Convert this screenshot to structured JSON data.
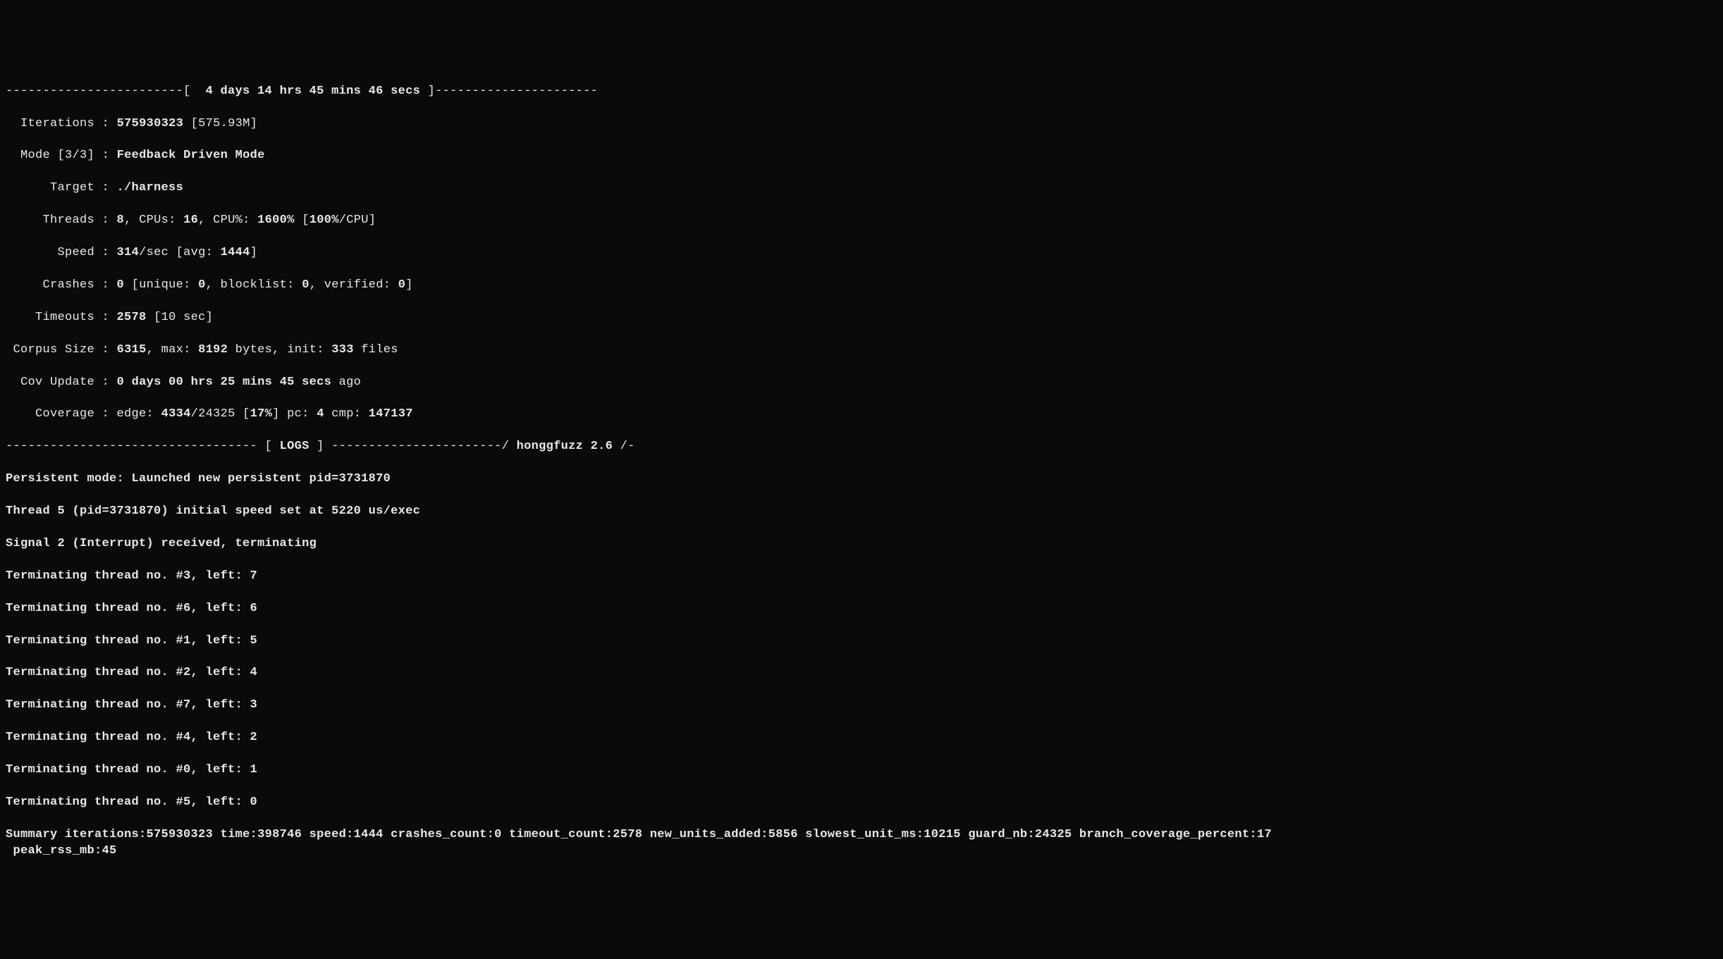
{
  "header": {
    "runtime": "4 days 14 hrs 45 mins 46 secs"
  },
  "stats": {
    "iterations": {
      "label": "Iterations",
      "value": "575930323",
      "human": "[575.93M]"
    },
    "mode": {
      "label": "Mode",
      "idx": "[3/3]",
      "value": "Feedback Driven Mode"
    },
    "target": {
      "label": "Target",
      "value": "./harness"
    },
    "threads": {
      "label": "Threads",
      "value": "8",
      "cpus_label": "CPUs:",
      "cpus": "16",
      "cpupct_label": "CPU%:",
      "cpupct": "1600%",
      "percpu": "100%",
      "percpu_suffix": "/CPU]"
    },
    "speed": {
      "label": "Speed",
      "value": "314",
      "unit": "/sec",
      "avg_label": "[avg:",
      "avg": "1444"
    },
    "crashes": {
      "label": "Crashes",
      "value": "0",
      "unique_label": "[unique:",
      "unique": "0",
      "blocklist_label": "blocklist:",
      "blocklist": "0",
      "verified_label": "verified:",
      "verified": "0"
    },
    "timeouts": {
      "label": "Timeouts",
      "value": "2578",
      "window": "[10 sec]"
    },
    "corpus": {
      "label": "Corpus Size",
      "value": "6315",
      "max_label": "max:",
      "max": "8192",
      "max_unit": "bytes,",
      "init_label": "init:",
      "init": "333",
      "init_unit": "files"
    },
    "covupdate": {
      "label": "Cov Update",
      "value": "0 days 00 hrs 25 mins 45 secs",
      "suffix": "ago"
    },
    "coverage": {
      "label": "Coverage",
      "edge_label": "edge:",
      "edge_num": "4334",
      "edge_den": "/24325",
      "edge_pct": "17%",
      "pc_label": "pc:",
      "pc": "4",
      "cmp_label": "cmp:",
      "cmp": "147137"
    }
  },
  "logs_header": {
    "title": "LOGS",
    "tool": "honggfuzz 2.6"
  },
  "logs": [
    "Persistent mode: Launched new persistent pid=3731870",
    "Thread 5 (pid=3731870) initial speed set at 5220 us/exec",
    "Signal 2 (Interrupt) received, terminating",
    "Terminating thread no. #3, left: 7",
    "Terminating thread no. #6, left: 6",
    "Terminating thread no. #1, left: 5",
    "Terminating thread no. #2, left: 4",
    "Terminating thread no. #7, left: 3",
    "Terminating thread no. #4, left: 2",
    "Terminating thread no. #0, left: 1",
    "Terminating thread no. #5, left: 0"
  ],
  "summary": {
    "prefix": "Summary",
    "iterations": "575930323",
    "time": "398746",
    "speed": "1444",
    "crashes_count": "0",
    "timeout_count": "2578",
    "new_units_added": "5856",
    "slowest_unit_ms": "10215",
    "guard_nb": "24325",
    "branch_coverage_percent": "17",
    "peak_rss_mb": "45"
  }
}
